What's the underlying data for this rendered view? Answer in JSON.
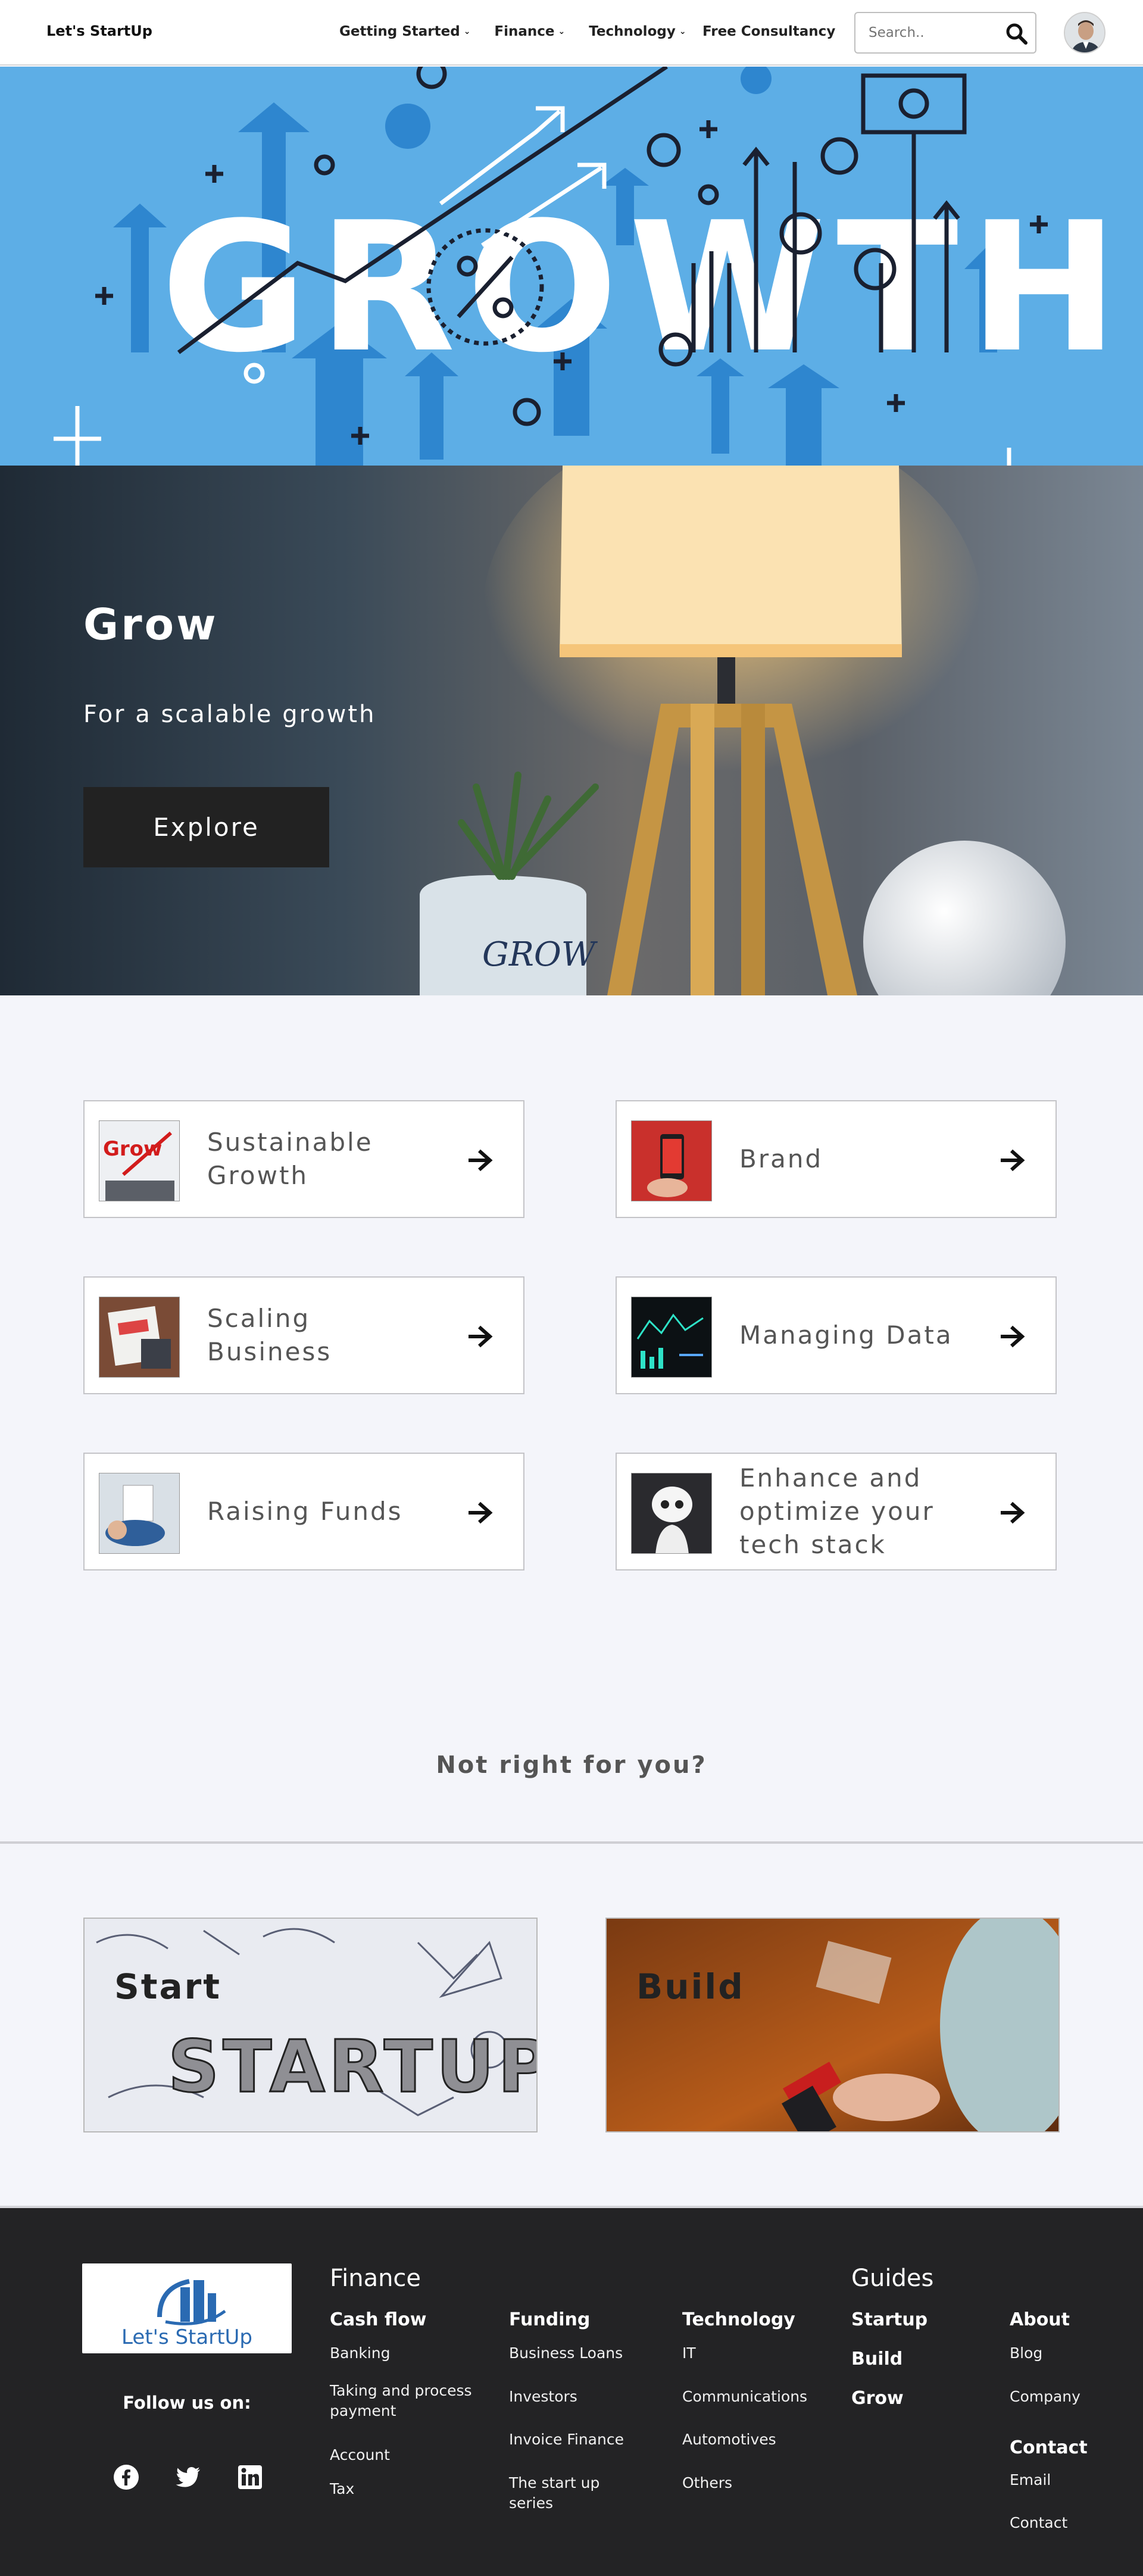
{
  "header": {
    "brand": "Let's StartUp",
    "nav": [
      {
        "label": "Getting Started"
      },
      {
        "label": "Finance"
      },
      {
        "label": "Technology"
      }
    ],
    "cta": "Free Consultancy",
    "search_placeholder": "Search.."
  },
  "banner": {
    "word": "GROWTH"
  },
  "hero": {
    "title": "Grow",
    "subtitle": "For a scalable growth",
    "button": "Explore"
  },
  "topics": [
    {
      "label": "Sustainable Growth"
    },
    {
      "label": "Brand"
    },
    {
      "label": "Scaling Business"
    },
    {
      "label": "Managing Data"
    },
    {
      "label": "Raising Funds"
    },
    {
      "label": "Enhance and optimize your tech stack"
    }
  ],
  "not_right": "Not right for you?",
  "paths": [
    {
      "label": "Start"
    },
    {
      "label": "Build"
    }
  ],
  "footer": {
    "logo_text": "Let's StartUp",
    "follow": "Follow us on:",
    "finance_heading": "Finance",
    "guides_heading": "Guides",
    "columns": {
      "cashflow": {
        "title": "Cash flow",
        "links": [
          "Banking",
          "Taking and process payment",
          "Account",
          "Tax"
        ]
      },
      "funding": {
        "title": "Funding",
        "links": [
          "Business Loans",
          "Investors",
          "Invoice Finance",
          "The start up series"
        ]
      },
      "technology": {
        "title": "Technology",
        "links": [
          "IT",
          "Communications",
          "Automotives",
          "Others"
        ]
      },
      "guides": {
        "links": [
          "Startup",
          "Build",
          "Grow"
        ]
      },
      "about": {
        "title": "About",
        "links": [
          "Blog",
          "Company"
        ]
      },
      "contact": {
        "title": "Contact",
        "links": [
          "Email",
          "Contact"
        ]
      }
    }
  },
  "colors": {
    "banner_blue": "#5daee6",
    "footer_dark": "#232325",
    "page_bg": "#f4f5fa",
    "button_dark": "#222222"
  }
}
